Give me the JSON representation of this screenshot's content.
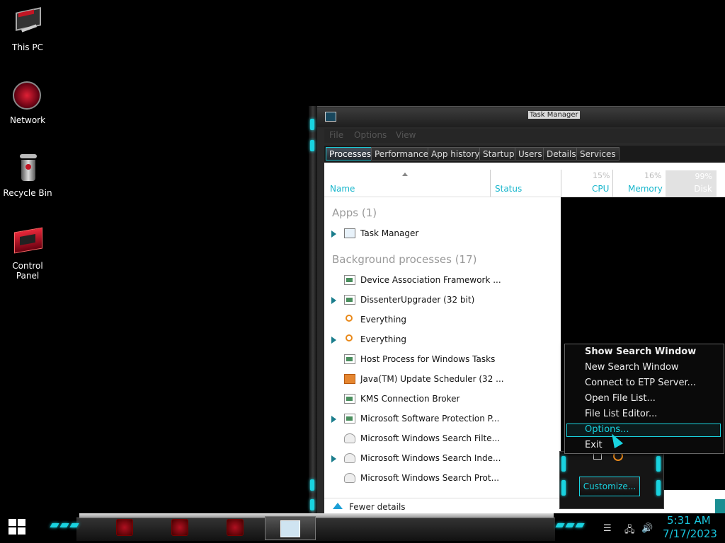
{
  "desktop": {
    "icons": [
      {
        "label": "This PC",
        "icon": "this-pc-icon"
      },
      {
        "label": "Network",
        "icon": "network-icon"
      },
      {
        "label": "Recycle Bin",
        "icon": "recycle-bin-icon"
      },
      {
        "label": "Control Panel",
        "icon": "control-panel-icon"
      }
    ]
  },
  "window": {
    "title": "Task Manager",
    "menu": [
      "File",
      "Options",
      "View"
    ],
    "tabs": [
      "Processes",
      "Performance",
      "App history",
      "Startup",
      "Users",
      "Details",
      "Services"
    ],
    "active_tab": "Processes",
    "columns": {
      "name": "Name",
      "status": "Status",
      "cpu": {
        "label": "CPU",
        "pct": "15%"
      },
      "memory": {
        "label": "Memory",
        "pct": "16%"
      },
      "disk": {
        "label": "Disk",
        "pct": "99%"
      }
    },
    "groups": {
      "apps": "Apps (1)",
      "background": "Background processes (17)"
    },
    "apps": [
      {
        "name": "Task Manager",
        "expandable": true,
        "icon": "task-manager-icon"
      }
    ],
    "background": [
      {
        "name": "Device Association Framework ...",
        "expandable": false,
        "icon": "window-icon"
      },
      {
        "name": "DissenterUpgrader (32 bit)",
        "expandable": true,
        "icon": "window-icon"
      },
      {
        "name": "Everything",
        "expandable": false,
        "icon": "magnifier-icon"
      },
      {
        "name": "Everything",
        "expandable": true,
        "icon": "magnifier-icon"
      },
      {
        "name": "Host Process for Windows Tasks",
        "expandable": false,
        "icon": "window-icon"
      },
      {
        "name": "Java(TM) Update Scheduler (32 ...",
        "expandable": false,
        "icon": "java-icon"
      },
      {
        "name": "KMS Connection Broker",
        "expandable": false,
        "icon": "window-icon"
      },
      {
        "name": "Microsoft Software Protection P...",
        "expandable": true,
        "icon": "window-icon"
      },
      {
        "name": "Microsoft Windows Search Filte...",
        "expandable": false,
        "icon": "user-icon"
      },
      {
        "name": "Microsoft Windows Search Inde...",
        "expandable": true,
        "icon": "user-icon"
      },
      {
        "name": "Microsoft Windows Search Prot...",
        "expandable": false,
        "icon": "user-icon"
      }
    ],
    "fewer_details": "Fewer details"
  },
  "context_menu": {
    "items": [
      "Show Search Window",
      "New Search Window",
      "Connect to ETP Server...",
      "Open File List...",
      "File List Editor...",
      "Options...",
      "Exit"
    ],
    "highlighted": "Options..."
  },
  "tray_flyout": {
    "customize": "Customize..."
  },
  "taskbar": {
    "time": "5:31 AM",
    "date": "7/17/2023"
  },
  "colors": {
    "accent": "#19d3e0",
    "column_text": "#18b6cc"
  }
}
